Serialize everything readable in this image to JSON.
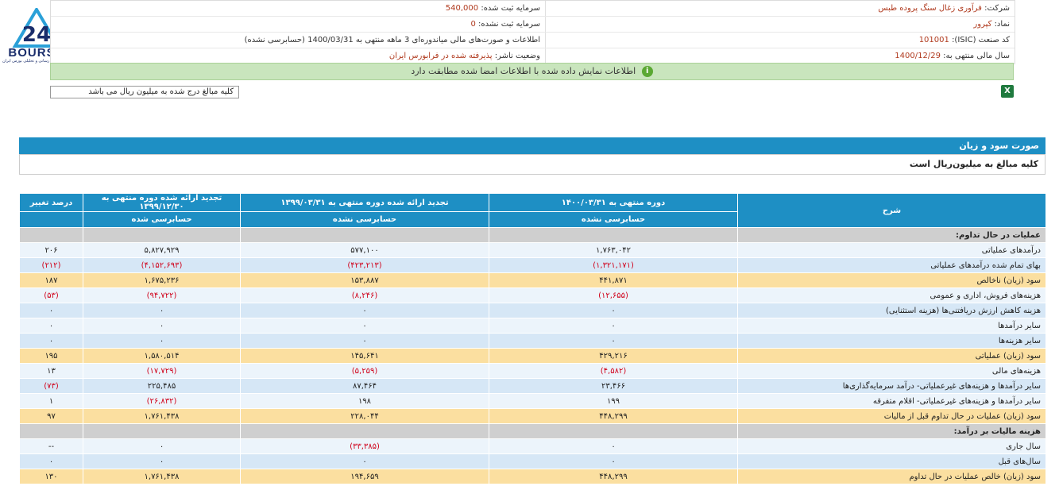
{
  "logo": {
    "brand": "BOURSE",
    "tagline": "پایگاه اطلاع رسانی و تحلیلی بورس ایران"
  },
  "company_info": {
    "rows": [
      {
        "label_r": "شرکت:",
        "value_r": "فرآوری زغال سنگ پروده طبس",
        "label_l": "سرمایه ثبت شده:",
        "value_l": "540,000"
      },
      {
        "label_r": "نماد:",
        "value_r": "کپرور",
        "label_l": "سرمایه ثبت نشده:",
        "value_l": "0"
      },
      {
        "label_r": "کد صنعت (ISIC):",
        "value_r": "101001",
        "label_l": "اطلاعات و صورت‌های مالی میاندوره‌ای 3 ماهه منتهی به 1400/03/31 (حسابرسی نشده)",
        "value_l": ""
      },
      {
        "label_r": "سال مالی منتهی به:",
        "value_r": "1400/12/29",
        "label_l": "وضعیت ناشر:",
        "value_l": "پذیرفته شده در فرابورس ایران"
      }
    ]
  },
  "banner": {
    "icon": "check-circle-icon",
    "text": "اطلاعات نمایش داده شده با اطلاعات امضا شده مطابقت دارد"
  },
  "note": "کلیه مبالغ درج شده به میلیون ریال می باشد",
  "excel_icon": "excel-export-icon",
  "section": {
    "title": "صورت سود و زیان",
    "subtitle": "کلیه مبالغ به میلیون‌ریال است"
  },
  "table": {
    "header_desc": "شرح",
    "header_pct": "درصد تغییر",
    "periods": [
      {
        "title": "دوره منتهی به ۱۴۰۰/۰۳/۳۱",
        "status": "حسابرسی نشده"
      },
      {
        "title": "تجدید ارائه شده دوره منتهی به ۱۳۹۹/۰۳/۳۱",
        "status": "حسابرسی نشده"
      },
      {
        "title": "تجدید ارائه شده دوره منتهی به ۱۳۹۹/۱۲/۳۰",
        "status": "حسابرسی شده"
      }
    ],
    "rows": [
      {
        "type": "sec",
        "desc": "عملیات در حال تداوم:",
        "p1": "",
        "p2": "",
        "p3": "",
        "pct": ""
      },
      {
        "type": "white",
        "desc": "درآمدهای عملیاتی",
        "p1": "۱,۷۶۳,۰۴۲",
        "p2": "۵۷۷,۱۰۰",
        "p3": "۵,۸۲۷,۹۲۹",
        "pct": "۲۰۶"
      },
      {
        "type": "blue",
        "desc": "بهای تمام شده درآمدهای عملیاتی",
        "p1": "(۱,۳۲۱,۱۷۱)",
        "p2": "(۴۲۳,۲۱۳)",
        "p3": "(۴,۱۵۲,۶۹۳)",
        "pct": "(۲۱۲)"
      },
      {
        "type": "yellow",
        "desc": "سود (زیان) ناخالص",
        "p1": "۴۴۱,۸۷۱",
        "p2": "۱۵۳,۸۸۷",
        "p3": "۱,۶۷۵,۲۳۶",
        "pct": "۱۸۷"
      },
      {
        "type": "white",
        "desc": "هزینه‌های فروش، اداری و عمومی",
        "p1": "(۱۲,۶۵۵)",
        "p2": "(۸,۲۴۶)",
        "p3": "(۹۴,۷۲۲)",
        "pct": "(۵۳)"
      },
      {
        "type": "blue",
        "desc": "هزینه کاهش ارزش دریافتنی‌ها (هزینه استثنایی)",
        "p1": "۰",
        "p2": "۰",
        "p3": "۰",
        "pct": "۰"
      },
      {
        "type": "white",
        "desc": "سایر درآمدها",
        "p1": "۰",
        "p2": "۰",
        "p3": "۰",
        "pct": "۰"
      },
      {
        "type": "blue",
        "desc": "سایر هزینه‌ها",
        "p1": "۰",
        "p2": "۰",
        "p3": "۰",
        "pct": "۰"
      },
      {
        "type": "yellow",
        "desc": "سود (زیان) عملیاتی",
        "p1": "۴۲۹,۲۱۶",
        "p2": "۱۴۵,۶۴۱",
        "p3": "۱,۵۸۰,۵۱۴",
        "pct": "۱۹۵"
      },
      {
        "type": "white",
        "desc": "هزینه‌های مالی",
        "p1": "(۴,۵۸۲)",
        "p2": "(۵,۲۵۹)",
        "p3": "(۱۷,۷۲۹)",
        "pct": "۱۳"
      },
      {
        "type": "blue",
        "desc": "سایر درآمدها و هزینه‌های غیرعملیاتی- درآمد سرمایه‌گذاری‌ها",
        "p1": "۲۳,۴۶۶",
        "p2": "۸۷,۴۶۴",
        "p3": "۲۲۵,۴۸۵",
        "pct": "(۷۳)"
      },
      {
        "type": "white",
        "desc": "سایر درآمدها و هزینه‌های غیرعملیاتی- اقلام متفرقه",
        "p1": "۱۹۹",
        "p2": "۱۹۸",
        "p3": "(۲۶,۸۳۲)",
        "pct": "۱"
      },
      {
        "type": "yellow",
        "desc": "سود (زیان) عملیات در حال تداوم قبل از مالیات",
        "p1": "۴۴۸,۲۹۹",
        "p2": "۲۲۸,۰۴۴",
        "p3": "۱,۷۶۱,۴۳۸",
        "pct": "۹۷"
      },
      {
        "type": "sec",
        "desc": "هزینه مالیات بر درآمد:",
        "p1": "",
        "p2": "",
        "p3": "",
        "pct": ""
      },
      {
        "type": "white",
        "desc": "سال جاری",
        "p1": "۰",
        "p2": "(۳۳,۳۸۵)",
        "p3": "۰",
        "pct": "--"
      },
      {
        "type": "blue",
        "desc": "سال‌های قبل",
        "p1": "۰",
        "p2": "۰",
        "p3": "۰",
        "pct": "۰"
      },
      {
        "type": "yellow",
        "desc": "سود (زیان) خالص عملیات در حال تداوم",
        "p1": "۴۴۸,۲۹۹",
        "p2": "۱۹۴,۶۵۹",
        "p3": "۱,۷۶۱,۴۳۸",
        "pct": "۱۳۰"
      }
    ]
  }
}
